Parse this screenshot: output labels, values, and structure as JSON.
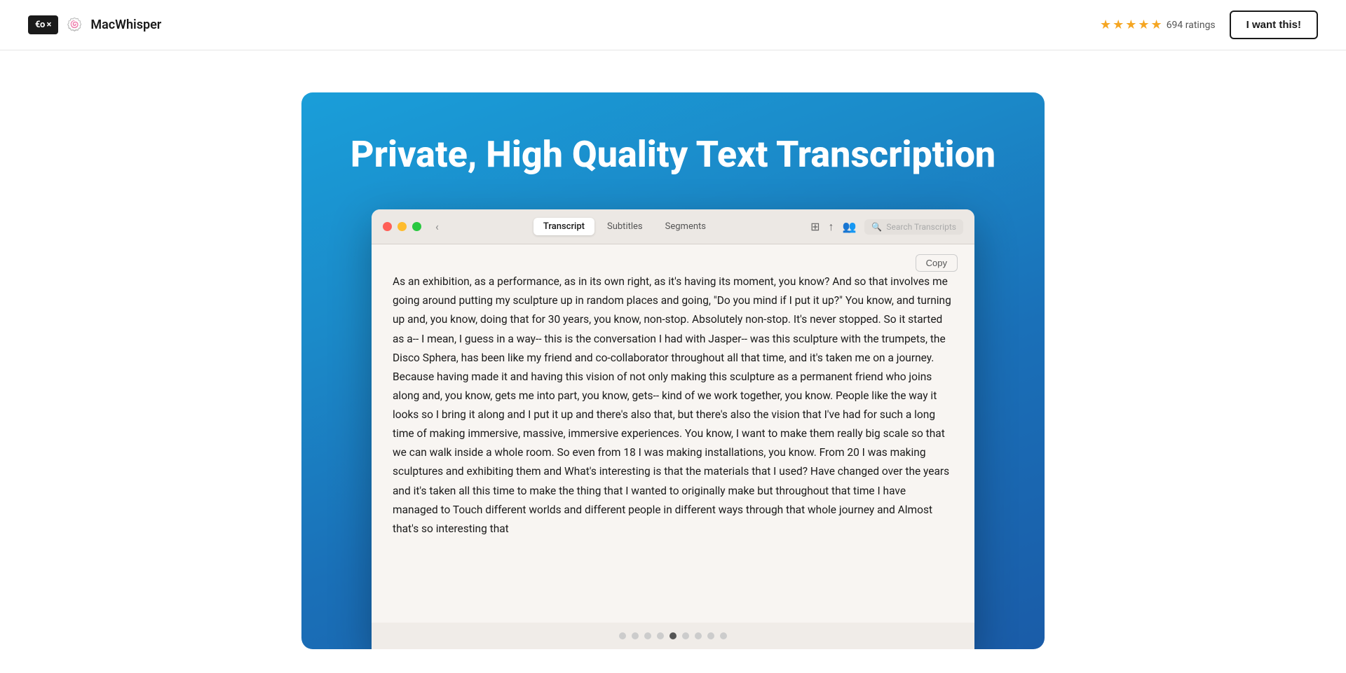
{
  "navbar": {
    "logo_text": "€o ×",
    "gumroad_icon": "🍥",
    "app_name": "MacWhisper",
    "stars_count": 5,
    "ratings_text": "694 ratings",
    "want_button_label": "I want this!"
  },
  "showcase": {
    "title": "Private, High Quality Text Transcription",
    "window": {
      "tabs": [
        {
          "label": "Transcript",
          "active": true
        },
        {
          "label": "Subtitles",
          "active": false
        },
        {
          "label": "Segments",
          "active": false
        }
      ],
      "toolbar_icons": [
        "grid-icon",
        "export-icon",
        "people-icon"
      ],
      "search_placeholder": "Search Transcripts",
      "copy_button_label": "Copy",
      "transcript_text": "As an exhibition, as a performance, as in its own right, as it's having its moment, you know? And so that involves me going around putting my sculpture up in random places and going, \"Do you mind if I put it up?\" You know, and turning up and, you know, doing that for 30 years, you know, non-stop. Absolutely non-stop. It's never stopped. So it started as a-- I mean, I guess in a way-- this is the conversation I had with Jasper-- was this sculpture with the trumpets, the Disco Sphera, has been like my friend and co-collaborator throughout all that time, and it's taken me on a journey. Because having made it and having this vision of not only making this sculpture as a permanent friend who joins along and, you know, gets me into part, you know, gets-- kind of we work together, you know. People like the way it looks so I bring it along and I put it up and there's also that, but there's also the vision that I've had for such a long time of making immersive, massive, immersive experiences. You know, I want to make them really big scale so that we can walk inside a whole room. So even from 18 I was making installations, you know. From 20 I was making sculptures and exhibiting them and What's interesting is that the materials that I used? Have changed over the years and it's taken all this time to make the thing that I wanted to originally make but throughout that time I have managed to Touch different worlds and different people in different ways through that whole journey and Almost that's so interesting that"
    },
    "carousel_dots": [
      {
        "active": false
      },
      {
        "active": false
      },
      {
        "active": false
      },
      {
        "active": false
      },
      {
        "active": true
      },
      {
        "active": false
      },
      {
        "active": false
      },
      {
        "active": false
      },
      {
        "active": false
      }
    ]
  }
}
